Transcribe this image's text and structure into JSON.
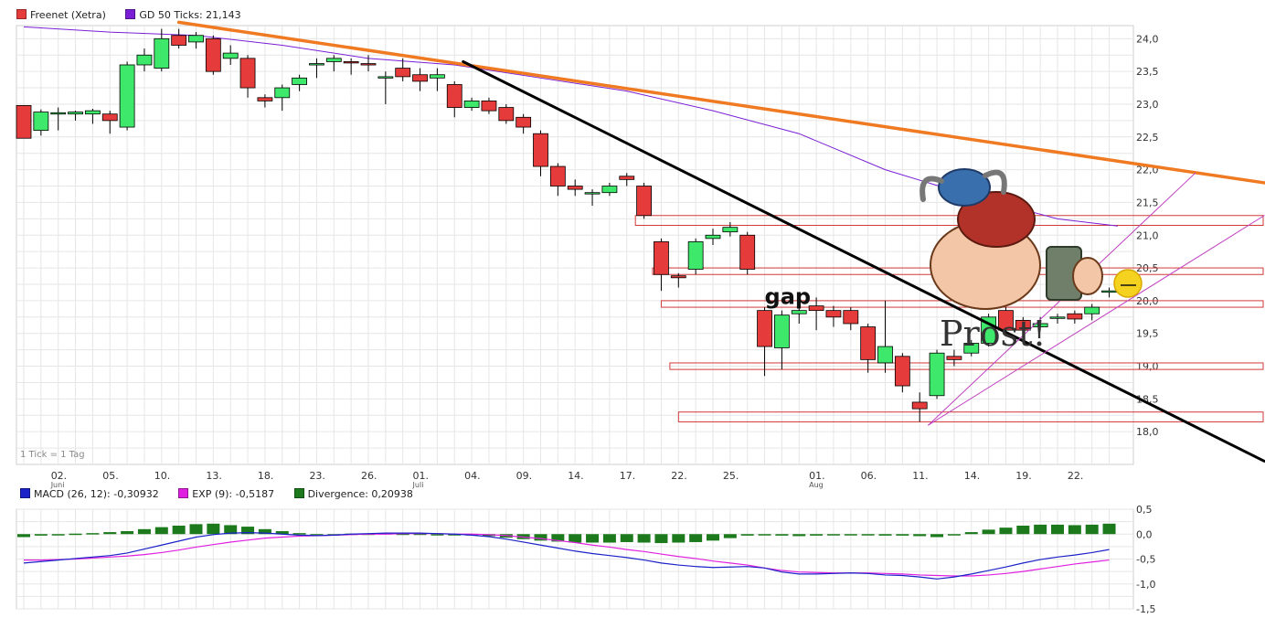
{
  "chart_data": [
    {
      "type": "candlestick",
      "legend": [
        {
          "label": "Freenet (Xetra)",
          "color": "#e53b3b"
        },
        {
          "label": "GD 50 Ticks: 21,143",
          "color": "#7a1fd6"
        }
      ],
      "note": "1 Tick = 1 Tag",
      "annotation": "gap",
      "sticker_text": "Prost!",
      "ylim": [
        17.5,
        24.2
      ],
      "y_ticks": [
        "24,0",
        "23,5",
        "23,0",
        "22,5",
        "22,0",
        "21,5",
        "21,0",
        "20,5",
        "20,0",
        "19,5",
        "19,0",
        "18,5",
        "18,0"
      ],
      "x_ticks": [
        {
          "label": "02.",
          "sub": "Juni",
          "i": 2
        },
        {
          "label": "05.",
          "i": 5
        },
        {
          "label": "10.",
          "i": 8
        },
        {
          "label": "13.",
          "i": 11
        },
        {
          "label": "18.",
          "i": 14
        },
        {
          "label": "23.",
          "i": 17
        },
        {
          "label": "26.",
          "i": 20
        },
        {
          "label": "01.",
          "sub": "Juli",
          "i": 23
        },
        {
          "label": "04.",
          "i": 26
        },
        {
          "label": "09.",
          "i": 29
        },
        {
          "label": "14.",
          "i": 32
        },
        {
          "label": "17.",
          "i": 35
        },
        {
          "label": "22.",
          "i": 38
        },
        {
          "label": "25.",
          "i": 41
        },
        {
          "label": "01.",
          "sub": "Aug",
          "i": 46
        },
        {
          "label": "06.",
          "i": 49
        },
        {
          "label": "11.",
          "i": 52
        },
        {
          "label": "14.",
          "i": 55
        },
        {
          "label": "19.",
          "i": 58
        },
        {
          "label": "22.",
          "i": 61
        }
      ],
      "candles": [
        [
          22.98,
          22.48,
          22.98,
          22.48
        ],
        [
          22.6,
          22.88,
          22.92,
          22.52
        ],
        [
          22.85,
          22.87,
          22.95,
          22.6
        ],
        [
          22.85,
          22.88,
          22.9,
          22.75
        ],
        [
          22.85,
          22.9,
          22.93,
          22.7
        ],
        [
          22.85,
          22.75,
          22.9,
          22.55
        ],
        [
          22.65,
          23.6,
          23.65,
          22.6
        ],
        [
          23.6,
          23.75,
          23.85,
          23.5
        ],
        [
          23.55,
          24.0,
          24.15,
          23.5
        ],
        [
          24.05,
          23.9,
          24.15,
          23.85
        ],
        [
          23.95,
          24.05,
          24.1,
          23.85
        ],
        [
          24.0,
          23.5,
          24.05,
          23.45
        ],
        [
          23.7,
          23.78,
          23.9,
          23.6
        ],
        [
          23.7,
          23.25,
          23.75,
          23.1
        ],
        [
          23.1,
          23.05,
          23.15,
          22.95
        ],
        [
          23.1,
          23.25,
          23.3,
          22.9
        ],
        [
          23.3,
          23.4,
          23.45,
          23.2
        ],
        [
          23.6,
          23.62,
          23.7,
          23.4
        ],
        [
          23.65,
          23.7,
          23.75,
          23.5
        ],
        [
          23.65,
          23.63,
          23.7,
          23.45
        ],
        [
          23.62,
          23.6,
          23.75,
          23.5
        ],
        [
          23.4,
          23.42,
          23.5,
          23.0
        ],
        [
          23.55,
          23.42,
          23.7,
          23.35
        ],
        [
          23.45,
          23.35,
          23.55,
          23.2
        ],
        [
          23.4,
          23.45,
          23.55,
          23.2
        ],
        [
          23.3,
          22.95,
          23.35,
          22.8
        ],
        [
          22.95,
          23.05,
          23.1,
          22.9
        ],
        [
          23.05,
          22.9,
          23.1,
          22.85
        ],
        [
          22.95,
          22.75,
          23.0,
          22.7
        ],
        [
          22.8,
          22.65,
          22.85,
          22.55
        ],
        [
          22.55,
          22.05,
          22.6,
          21.9
        ],
        [
          22.05,
          21.75,
          22.1,
          21.6
        ],
        [
          21.75,
          21.7,
          21.85,
          21.6
        ],
        [
          21.65,
          21.65,
          21.7,
          21.45
        ],
        [
          21.65,
          21.75,
          21.8,
          21.6
        ],
        [
          21.9,
          21.85,
          21.95,
          21.75
        ],
        [
          21.75,
          21.3,
          21.8,
          21.25
        ],
        [
          20.9,
          20.4,
          20.95,
          20.15
        ],
        [
          20.38,
          20.35,
          20.42,
          20.2
        ],
        [
          20.48,
          20.9,
          20.95,
          20.4
        ],
        [
          20.95,
          21.0,
          21.1,
          20.85
        ],
        [
          21.05,
          21.12,
          21.2,
          20.98
        ],
        [
          21.0,
          20.48,
          21.05,
          20.4
        ],
        [
          19.85,
          19.3,
          19.9,
          18.85
        ],
        [
          19.28,
          19.78,
          19.85,
          18.95
        ],
        [
          19.8,
          19.85,
          19.95,
          19.65
        ],
        [
          19.92,
          19.85,
          20.05,
          19.55
        ],
        [
          19.85,
          19.75,
          19.92,
          19.6
        ],
        [
          19.85,
          19.65,
          19.9,
          19.55
        ],
        [
          19.6,
          19.1,
          19.65,
          18.9
        ],
        [
          19.05,
          19.3,
          20.0,
          18.9
        ],
        [
          19.15,
          18.7,
          19.2,
          18.6
        ],
        [
          18.45,
          18.35,
          18.6,
          18.15
        ],
        [
          18.55,
          19.2,
          19.25,
          18.5
        ],
        [
          19.15,
          19.1,
          19.25,
          19.0
        ],
        [
          19.2,
          19.35,
          19.4,
          19.15
        ],
        [
          19.35,
          19.75,
          19.8,
          19.3
        ],
        [
          19.85,
          19.55,
          19.9,
          19.5
        ],
        [
          19.7,
          19.55,
          19.75,
          19.5
        ],
        [
          19.6,
          19.65,
          19.75,
          19.55
        ],
        [
          19.75,
          19.75,
          19.8,
          19.65
        ],
        [
          19.8,
          19.72,
          19.85,
          19.65
        ],
        [
          19.8,
          19.9,
          19.95,
          19.7
        ],
        [
          20.15,
          20.15,
          20.2,
          20.05
        ]
      ],
      "ma50": [
        [
          0,
          24.18
        ],
        [
          5,
          24.1
        ],
        [
          10,
          24.05
        ],
        [
          15,
          23.9
        ],
        [
          20,
          23.7
        ],
        [
          25,
          23.6
        ],
        [
          30,
          23.4
        ],
        [
          35,
          23.2
        ],
        [
          40,
          22.9
        ],
        [
          45,
          22.55
        ],
        [
          50,
          22.0
        ],
        [
          55,
          21.6
        ],
        [
          60,
          21.25
        ],
        [
          63.5,
          21.14
        ]
      ],
      "trendlines": [
        {
          "color": "#f07a22",
          "from": [
            9,
            24.25
          ],
          "to": [
            72,
            21.8
          ]
        },
        {
          "color": "#000000",
          "from": [
            25.5,
            23.65
          ],
          "to": [
            72,
            17.55
          ]
        },
        {
          "color": "#c040c0",
          "from": [
            52.5,
            18.1
          ],
          "to": [
            72,
            21.3
          ]
        },
        {
          "color": "#c040c0",
          "from": [
            52.5,
            18.1
          ],
          "to": [
            68,
            21.95
          ]
        }
      ],
      "support_zones": [
        {
          "from": 35.5,
          "y1": 21.3,
          "y2": 21.15
        },
        {
          "from": 36.5,
          "y1": 20.5,
          "y2": 20.4
        },
        {
          "from": 37,
          "y1": 20.0,
          "y2": 19.9
        },
        {
          "from": 37.5,
          "y1": 19.05,
          "y2": 18.95
        },
        {
          "from": 38,
          "y1": 18.3,
          "y2": 18.15
        }
      ]
    },
    {
      "type": "line",
      "legend": [
        {
          "label": "MACD (26, 12): -0,30932",
          "color": "#1a22c8"
        },
        {
          "label": "EXP (9): -0,5187",
          "color": "#e020e0"
        },
        {
          "label": "Divergence: 0,20938",
          "color": "#1c7a1c"
        }
      ],
      "ylim": [
        -1.5,
        0.5
      ],
      "y_ticks": [
        "0,5",
        "0,0",
        "-0,5",
        "-1,0",
        "-1,5"
      ],
      "macd": [
        -0.58,
        -0.55,
        -0.52,
        -0.49,
        -0.46,
        -0.43,
        -0.38,
        -0.3,
        -0.22,
        -0.14,
        -0.06,
        -0.01,
        0.02,
        0.03,
        0.02,
        0.0,
        -0.02,
        -0.03,
        -0.02,
        0.0,
        0.01,
        0.02,
        0.02,
        0.02,
        0.01,
        0.0,
        -0.02,
        -0.05,
        -0.1,
        -0.16,
        -0.22,
        -0.28,
        -0.34,
        -0.39,
        -0.43,
        -0.47,
        -0.52,
        -0.58,
        -0.62,
        -0.65,
        -0.67,
        -0.66,
        -0.65,
        -0.68,
        -0.76,
        -0.8,
        -0.8,
        -0.79,
        -0.78,
        -0.79,
        -0.82,
        -0.83,
        -0.86,
        -0.9,
        -0.86,
        -0.8,
        -0.73,
        -0.66,
        -0.58,
        -0.51,
        -0.46,
        -0.42,
        -0.37,
        -0.31
      ],
      "exp": [
        -0.52,
        -0.52,
        -0.51,
        -0.5,
        -0.48,
        -0.46,
        -0.44,
        -0.41,
        -0.37,
        -0.32,
        -0.26,
        -0.21,
        -0.16,
        -0.12,
        -0.08,
        -0.06,
        -0.04,
        -0.03,
        -0.02,
        -0.01,
        0.0,
        0.0,
        0.01,
        0.01,
        0.01,
        0.0,
        0.0,
        -0.01,
        -0.03,
        -0.06,
        -0.09,
        -0.13,
        -0.17,
        -0.22,
        -0.26,
        -0.31,
        -0.35,
        -0.4,
        -0.45,
        -0.49,
        -0.54,
        -0.58,
        -0.62,
        -0.68,
        -0.73,
        -0.76,
        -0.77,
        -0.78,
        -0.78,
        -0.78,
        -0.79,
        -0.8,
        -0.82,
        -0.83,
        -0.84,
        -0.84,
        -0.82,
        -0.79,
        -0.75,
        -0.7,
        -0.65,
        -0.6,
        -0.56,
        -0.52
      ],
      "divergence": [
        -0.06,
        -0.03,
        -0.01,
        0.01,
        0.02,
        0.04,
        0.06,
        0.1,
        0.14,
        0.17,
        0.2,
        0.21,
        0.18,
        0.15,
        0.1,
        0.06,
        0.02,
        0.0,
        0.0,
        0.01,
        0.01,
        0.02,
        0.01,
        0.01,
        0.0,
        0.0,
        -0.02,
        -0.04,
        -0.07,
        -0.1,
        -0.13,
        -0.15,
        -0.17,
        -0.17,
        -0.17,
        -0.16,
        -0.17,
        -0.18,
        -0.17,
        -0.16,
        -0.13,
        -0.08,
        -0.03,
        0.0,
        -0.03,
        -0.04,
        -0.03,
        -0.01,
        0.0,
        -0.01,
        -0.03,
        -0.03,
        -0.04,
        -0.06,
        -0.02,
        0.04,
        0.09,
        0.13,
        0.17,
        0.19,
        0.19,
        0.18,
        0.19,
        0.21
      ]
    }
  ]
}
